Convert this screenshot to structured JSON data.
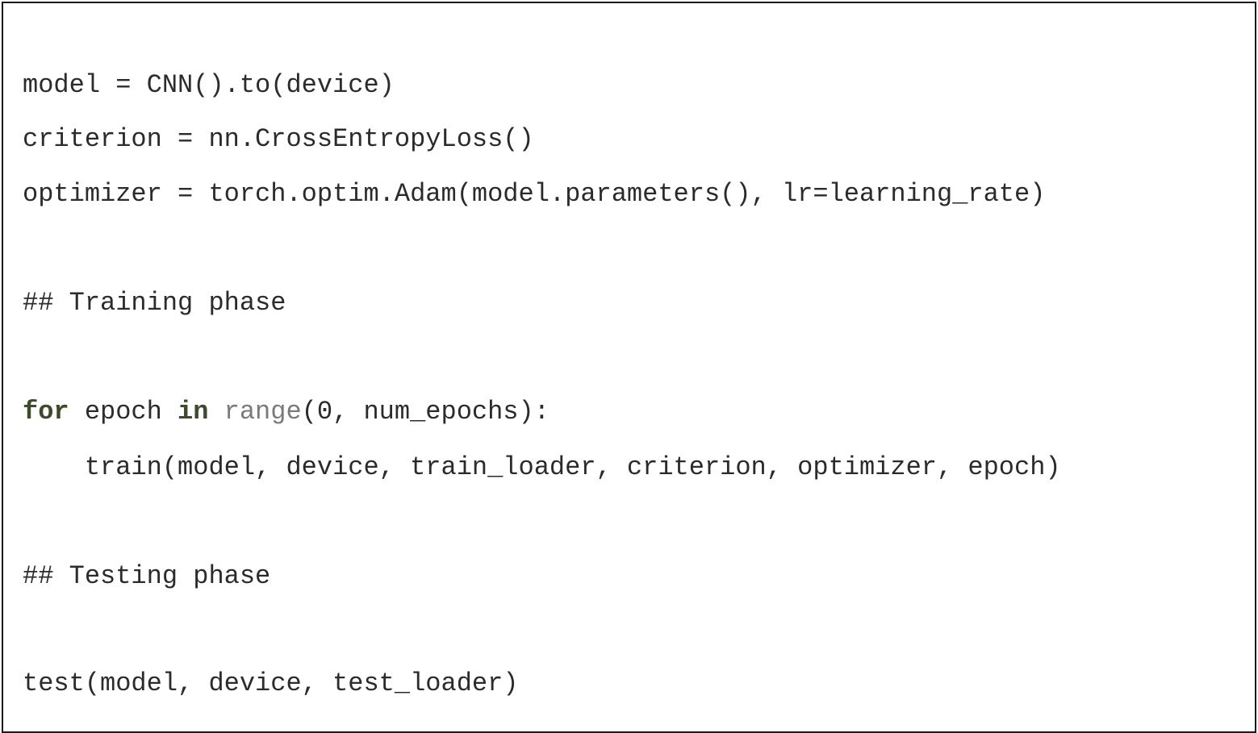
{
  "code": {
    "line1": "model = CNN().to(device)",
    "line2": "criterion = nn.CrossEntropyLoss()",
    "line3": "optimizer = torch.optim.Adam(model.parameters(), lr=learning_rate)",
    "comment_training": "## Training phase",
    "for_keyword": "for",
    "for_var": " epoch ",
    "in_keyword": "in",
    "space": " ",
    "range_builtin": "range",
    "for_rest": "(0, num_epochs):",
    "train_call": "    train(model, device, train_loader, criterion, optimizer, epoch)",
    "comment_testing": "## Testing phase",
    "test_call": "test(model, device, test_loader)"
  },
  "colors": {
    "text": "#2b2b2b",
    "keyword": "#3d4a2b",
    "builtin": "#7a7a7a",
    "border": "#1a1a1a"
  }
}
